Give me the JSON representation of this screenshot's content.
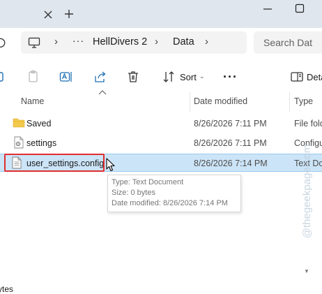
{
  "tabs": {
    "close_icon": "close-icon",
    "new_tab_icon": "plus-icon"
  },
  "window": {
    "minimize_icon": "minimize-icon",
    "maximize_icon": "maximize-icon"
  },
  "breadcrumb": {
    "root_icon": "computer-icon",
    "overflow": "···",
    "separator": "›",
    "items": [
      "HellDivers 2",
      "Data"
    ]
  },
  "search": {
    "placeholder": "Search Dat"
  },
  "command_bar": {
    "sort_label": "Sort",
    "sort_chevron": "⌄",
    "more_label": "···",
    "details_label": "Deta"
  },
  "columns": {
    "name": "Name",
    "date": "Date modified",
    "type": "Type"
  },
  "files": [
    {
      "name": "Saved",
      "date": "8/26/2026 7:11 PM",
      "type": "File fold",
      "icon": "folder-icon"
    },
    {
      "name": "settings",
      "date": "8/26/2026 7:11 PM",
      "type": "Configu",
      "icon": "config-file-icon"
    },
    {
      "name": "user_settings.config",
      "date": "8/26/2026 7:14 PM",
      "type": "Text Do",
      "icon": "text-file-icon",
      "selected": true
    }
  ],
  "tooltip": {
    "type_line": "Type: Text Document",
    "size_line": "Size: 0 bytes",
    "date_line": "Date modified: 8/26/2026 7:14 PM"
  },
  "status": {
    "size_text": "ytes"
  },
  "watermark": "@thegeekpage.com",
  "colors": {
    "selection": "#cce4f7",
    "highlight_box": "#e02e2e",
    "folder": "#f2c94c"
  }
}
